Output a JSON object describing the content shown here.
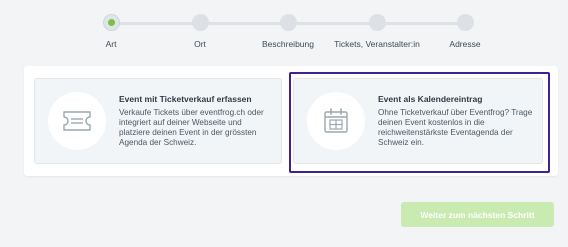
{
  "stepper": {
    "steps": [
      {
        "label": "Art",
        "active": true
      },
      {
        "label": "Ort",
        "active": false
      },
      {
        "label": "Beschreibung",
        "active": false
      },
      {
        "label": "Tickets, Veranstalter:in",
        "active": false
      },
      {
        "label": "Adresse",
        "active": false
      }
    ],
    "accent": "#7bc043"
  },
  "options": [
    {
      "title": "Event mit Ticketverkauf erfassen",
      "description": "Verkaufe Tickets über eventfrog.ch oder integriert auf deiner Webseite und platziere deinen Event in der grössten Agenda der Schweiz.",
      "icon": "ticket-icon",
      "selected": false
    },
    {
      "title": "Event als Kalendereintrag",
      "description": "Ohne Ticketverkauf über Eventfrog? Trage deinen Event kostenlos in die reichweitenstärkste Eventagenda der Schweiz ein.",
      "icon": "calendar-icon",
      "selected": true
    }
  ],
  "next_button": {
    "label": "Weiter zum nächsten Schritt",
    "enabled": false
  },
  "colors": {
    "selection_outline": "#3f2096",
    "button": "#c9eab0"
  }
}
